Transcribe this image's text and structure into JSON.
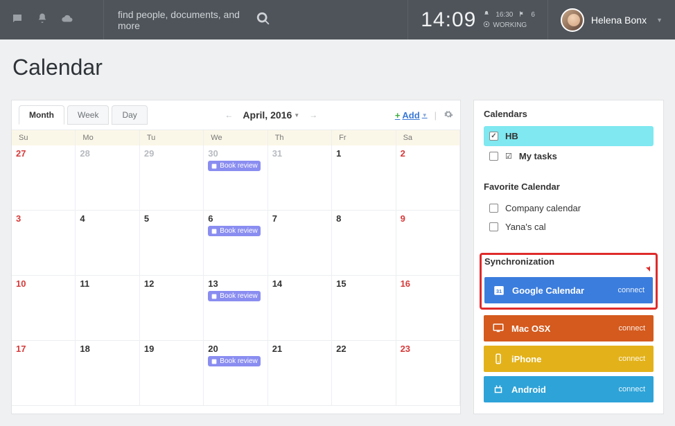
{
  "topbar": {
    "search_placeholder": "find people, documents, and more",
    "clock": "14:09",
    "notif_time": "16:30",
    "flag_count": "6",
    "status": "WORKING",
    "username": "Helena Bonx"
  },
  "page": {
    "title": "Calendar"
  },
  "calendar": {
    "tabs": {
      "month": "Month",
      "week": "Week",
      "day": "Day"
    },
    "month_label": "April, 2016",
    "add_label": "Add",
    "weekdays": [
      "Su",
      "Mo",
      "Tu",
      "We",
      "Th",
      "Fr",
      "Sa"
    ],
    "event_label": "Book review",
    "rows": [
      [
        {
          "n": "27",
          "cls": "gray red"
        },
        {
          "n": "28",
          "cls": "gray"
        },
        {
          "n": "29",
          "cls": "gray"
        },
        {
          "n": "30",
          "cls": "gray",
          "evt": true
        },
        {
          "n": "31",
          "cls": "gray"
        },
        {
          "n": "1",
          "cls": ""
        },
        {
          "n": "2",
          "cls": "red"
        }
      ],
      [
        {
          "n": "3",
          "cls": "red"
        },
        {
          "n": "4",
          "cls": ""
        },
        {
          "n": "5",
          "cls": ""
        },
        {
          "n": "6",
          "cls": "",
          "evt": true
        },
        {
          "n": "7",
          "cls": ""
        },
        {
          "n": "8",
          "cls": ""
        },
        {
          "n": "9",
          "cls": "red"
        }
      ],
      [
        {
          "n": "10",
          "cls": "red"
        },
        {
          "n": "11",
          "cls": ""
        },
        {
          "n": "12",
          "cls": ""
        },
        {
          "n": "13",
          "cls": "",
          "evt": true
        },
        {
          "n": "14",
          "cls": ""
        },
        {
          "n": "15",
          "cls": ""
        },
        {
          "n": "16",
          "cls": "red"
        }
      ],
      [
        {
          "n": "17",
          "cls": "red"
        },
        {
          "n": "18",
          "cls": ""
        },
        {
          "n": "19",
          "cls": ""
        },
        {
          "n": "20",
          "cls": "",
          "evt": true
        },
        {
          "n": "21",
          "cls": ""
        },
        {
          "n": "22",
          "cls": ""
        },
        {
          "n": "23",
          "cls": "red"
        }
      ]
    ]
  },
  "sidebar": {
    "calendars_title": "Calendars",
    "hb_label": "HB",
    "mytasks_label": "My tasks",
    "fav_title": "Favorite Calendar",
    "fav": [
      "Company calendar",
      "Yana's cal"
    ],
    "sync_title": "Synchronization",
    "sync": {
      "google": "Google Calendar",
      "mac": "Mac OSX",
      "iphone": "iPhone",
      "android": "Android",
      "connect": "connect"
    }
  }
}
